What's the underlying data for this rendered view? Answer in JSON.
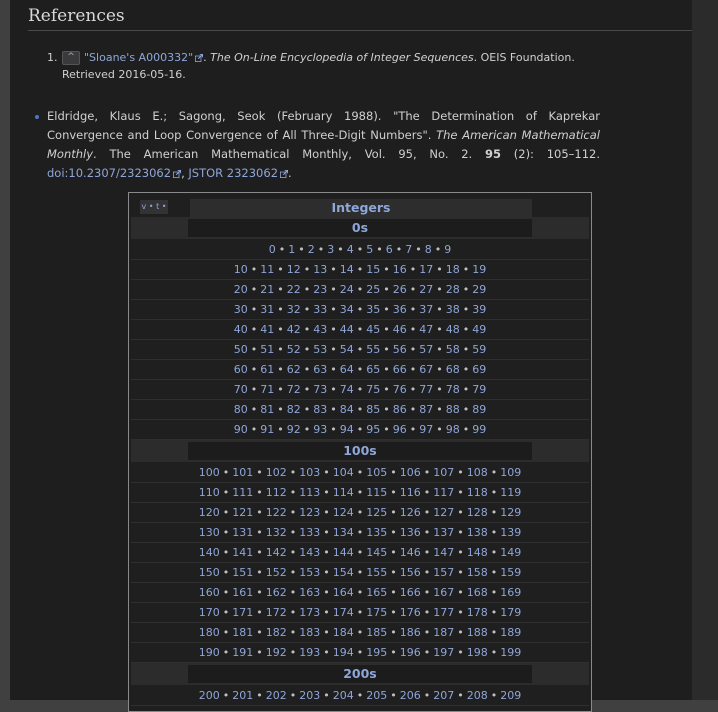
{
  "heading": "References",
  "ref1": {
    "num": "1.",
    "caret": "^",
    "link_text": "\"Sloane's A000332\"",
    "after_link": ". ",
    "italic": "The On-Line Encyclopedia of Integer Sequences",
    "after_italic": ". OEIS Foundation.",
    "line2": "Retrieved 2016-05-16."
  },
  "ref2": {
    "line1": "Eldridge, Klaus E.; Sagong, Seok (February 1988). \"The Determination of Kaprekar",
    "line2_plain": "Convergence and Loop Convergence of All Three-Digit Numbers\". ",
    "line2_italic": "The American Mathematical",
    "line3_italic": "Monthly",
    "line3_plain": ". The American Mathematical Monthly, Vol. 95, No. 2. ",
    "line3_bold": "95",
    "line3_tail": " (2): 105–112.",
    "doi_label": "doi",
    "doi_value": ":10.2307/2323062",
    "jstor": "JSTOR 2323062",
    "end": "."
  },
  "navbox": {
    "vte": "v • t • e",
    "title": "Integers",
    "groups": [
      {
        "label": "0s",
        "rows": [
          [
            "0",
            "1",
            "2",
            "3",
            "4",
            "5",
            "6",
            "7",
            "8",
            "9"
          ],
          [
            "10",
            "11",
            "12",
            "13",
            "14",
            "15",
            "16",
            "17",
            "18",
            "19"
          ],
          [
            "20",
            "21",
            "22",
            "23",
            "24",
            "25",
            "26",
            "27",
            "28",
            "29"
          ],
          [
            "30",
            "31",
            "32",
            "33",
            "34",
            "35",
            "36",
            "37",
            "38",
            "39"
          ],
          [
            "40",
            "41",
            "42",
            "43",
            "44",
            "45",
            "46",
            "47",
            "48",
            "49"
          ],
          [
            "50",
            "51",
            "52",
            "53",
            "54",
            "55",
            "56",
            "57",
            "58",
            "59"
          ],
          [
            "60",
            "61",
            "62",
            "63",
            "64",
            "65",
            "66",
            "67",
            "68",
            "69"
          ],
          [
            "70",
            "71",
            "72",
            "73",
            "74",
            "75",
            "76",
            "77",
            "78",
            "79"
          ],
          [
            "80",
            "81",
            "82",
            "83",
            "84",
            "85",
            "86",
            "87",
            "88",
            "89"
          ],
          [
            "90",
            "91",
            "92",
            "93",
            "94",
            "95",
            "96",
            "97",
            "98",
            "99"
          ]
        ]
      },
      {
        "label": "100s",
        "rows": [
          [
            "100",
            "101",
            "102",
            "103",
            "104",
            "105",
            "106",
            "107",
            "108",
            "109"
          ],
          [
            "110",
            "111",
            "112",
            "113",
            "114",
            "115",
            "116",
            "117",
            "118",
            "119"
          ],
          [
            "120",
            "121",
            "122",
            "123",
            "124",
            "125",
            "126",
            "127",
            "128",
            "129"
          ],
          [
            "130",
            "131",
            "132",
            "133",
            "134",
            "135",
            "136",
            "137",
            "138",
            "139"
          ],
          [
            "140",
            "141",
            "142",
            "143",
            "144",
            "145",
            "146",
            "147",
            "148",
            "149"
          ],
          [
            "150",
            "151",
            "152",
            "153",
            "154",
            "155",
            "156",
            "157",
            "158",
            "159"
          ],
          [
            "160",
            "161",
            "162",
            "163",
            "164",
            "165",
            "166",
            "167",
            "168",
            "169"
          ],
          [
            "170",
            "171",
            "172",
            "173",
            "174",
            "175",
            "176",
            "177",
            "178",
            "179"
          ],
          [
            "180",
            "181",
            "182",
            "183",
            "184",
            "185",
            "186",
            "187",
            "188",
            "189"
          ],
          [
            "190",
            "191",
            "192",
            "193",
            "194",
            "195",
            "196",
            "197",
            "198",
            "199"
          ]
        ]
      },
      {
        "label": "200s",
        "rows": [
          [
            "200",
            "201",
            "202",
            "203",
            "204",
            "205",
            "206",
            "207",
            "208",
            "209"
          ]
        ]
      }
    ],
    "separator": "•"
  },
  "colors": {
    "link": "#8fa6d8",
    "page_bg": "#1e1e1e",
    "outer_bg": "#404040"
  }
}
